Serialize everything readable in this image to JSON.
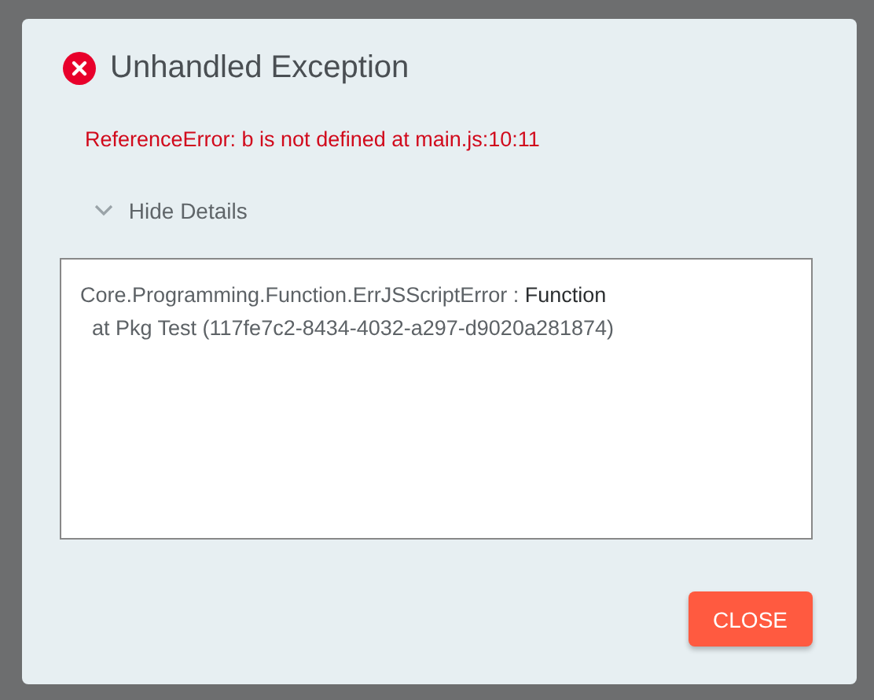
{
  "dialog": {
    "title": "Unhandled Exception",
    "message": "ReferenceError: b is not defined at main.js:10:11",
    "details_toggle": {
      "label": "Hide Details",
      "expanded": true
    },
    "details": [
      {
        "text": "Core.Programming.Function.ErrJSScriptError : ",
        "emphasis": "Function"
      },
      {
        "text": "  at Pkg Test (117fe7c2-8434-4032-a297-d9020a281874)"
      }
    ],
    "buttons": [
      "CLOSE"
    ]
  }
}
